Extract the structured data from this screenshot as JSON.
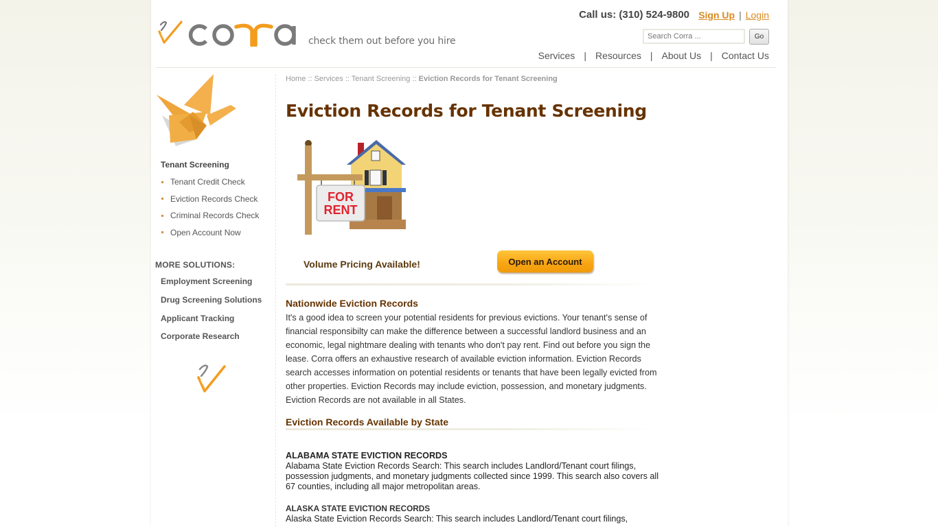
{
  "header": {
    "brand": "corra",
    "tagline": "check them out before you hire",
    "call_us": "Call us: (310) 524-9800",
    "sign_up": "Sign Up",
    "separator": "|",
    "login": "Login",
    "search": {
      "placeholder": "Search Corra ...",
      "value": "",
      "go_label": "Go"
    },
    "nav": [
      {
        "label": "Services"
      },
      {
        "label": "Resources"
      },
      {
        "label": "About Us"
      },
      {
        "label": "Contact Us"
      }
    ],
    "nav_separator": "|"
  },
  "sidebar": {
    "image": "origami-crane-icon",
    "heading": "Tenant Screening",
    "items": [
      {
        "label": "Tenant Credit Check"
      },
      {
        "label": "Eviction Records Check"
      },
      {
        "label": "Criminal Records Check"
      },
      {
        "label": "Open Account Now"
      }
    ],
    "more_title": "MORE SOLUTIONS:",
    "more_items": [
      {
        "label": "Employment Screening"
      },
      {
        "label": "Drug Screening Solutions"
      },
      {
        "label": "Applicant Tracking"
      },
      {
        "label": "Corporate Research"
      }
    ],
    "footer_icon": "checkmark-logo-icon"
  },
  "main": {
    "breadcrumb": [
      {
        "label": "Home"
      },
      {
        "label": "Services"
      },
      {
        "label": "Tenant Screening"
      },
      {
        "label": "Eviction Records for Tenant Screening"
      }
    ],
    "breadcrumb_sep": " :: ",
    "title": "Eviction Records for Tenant Screening",
    "hero_image": {
      "sign_line1": "FOR",
      "sign_line2": "RENT"
    },
    "volume_pricing": "Volume Pricing Available!",
    "open_account": "Open an Account",
    "nationwide_heading": "Nationwide Eviction Records",
    "intro": "It's a good idea to screen your potential residents for previous evictions. Your tenant's sense of financial responsibilty can make the difference between a successful landlord business and an economic, legal nightmare dealing with tenants who don't pay rent. Find out before you sign the lease. Corra offers an exhaustive research of available eviction information. Eviction Records search accesses information on potential residents or tenants that have been legally evicted from other properties. Eviction Records may include eviction, possession, and monetary judgments. Eviction Records are not available in all States.",
    "by_state_heading": "Eviction Records Available by State",
    "states": [
      {
        "title": "ALABAMA STATE EVICTION RECORDS",
        "text": "Alabama State Eviction Records Search: This search includes Landlord/Tenant court filings, possession judgments, and monetary judgments collected since 1999. This search also covers all 67 counties, including all major metropolitan areas."
      },
      {
        "title": "ALASKA STATE EVICTION RECORDS",
        "text": "Alaska State Eviction Records Search: This search includes Landlord/Tenant court filings,"
      }
    ]
  },
  "colors": {
    "brand_orange": "#f39c1e",
    "brand_gray": "#7a7a7a",
    "heading_brown": "#663300",
    "link_orange": "#d98a21",
    "button_orange": "#f7a514"
  }
}
